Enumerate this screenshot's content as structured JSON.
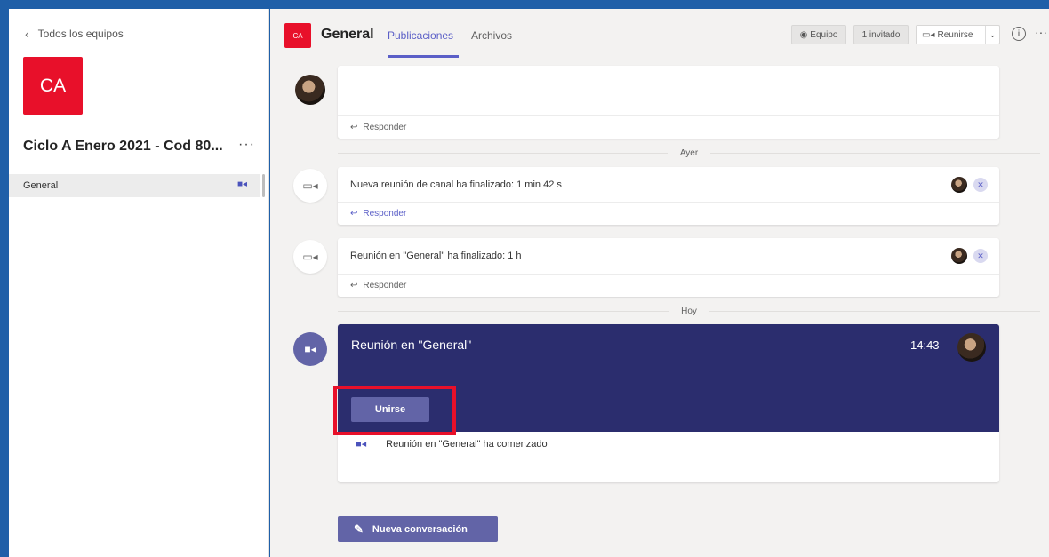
{
  "sidebar": {
    "back_label": "Todos los equipos",
    "team_initials": "CA",
    "team_name": "Ciclo A Enero 2021 - Cod 80...",
    "more_label": "···",
    "channels": [
      {
        "label": "General"
      }
    ]
  },
  "header": {
    "channel_initials": "CA",
    "channel_title": "General",
    "tabs": [
      {
        "label": "Publicaciones"
      },
      {
        "label": "Archivos"
      }
    ],
    "team_button": "Equipo",
    "invited_button": "1 invitado",
    "meet_button": "Reunirse",
    "info_icon": "i",
    "more_label": "···"
  },
  "feed": {
    "reply_label": "Responder",
    "separators": [
      "Ayer",
      "Hoy"
    ],
    "messages": [
      {
        "text": ""
      },
      {
        "text": "Nueva reunión de canal ha finalizado: 1 min 42 s"
      },
      {
        "text": "Reunión en \"General\" ha finalizado: 1 h"
      }
    ],
    "meeting": {
      "title": "Reunión en \"General\"",
      "time": "14:43",
      "join_label": "Unirse",
      "started_text": "Reunión en \"General\" ha comenzado"
    },
    "new_conversation_label": "Nueva conversación"
  },
  "colors": {
    "accent": "#5b5fc7",
    "team_avatar": "#e8102a",
    "meeting_banner": "#2b2d6e",
    "highlight": "#e8102a",
    "frame": "#1f5fa8"
  }
}
